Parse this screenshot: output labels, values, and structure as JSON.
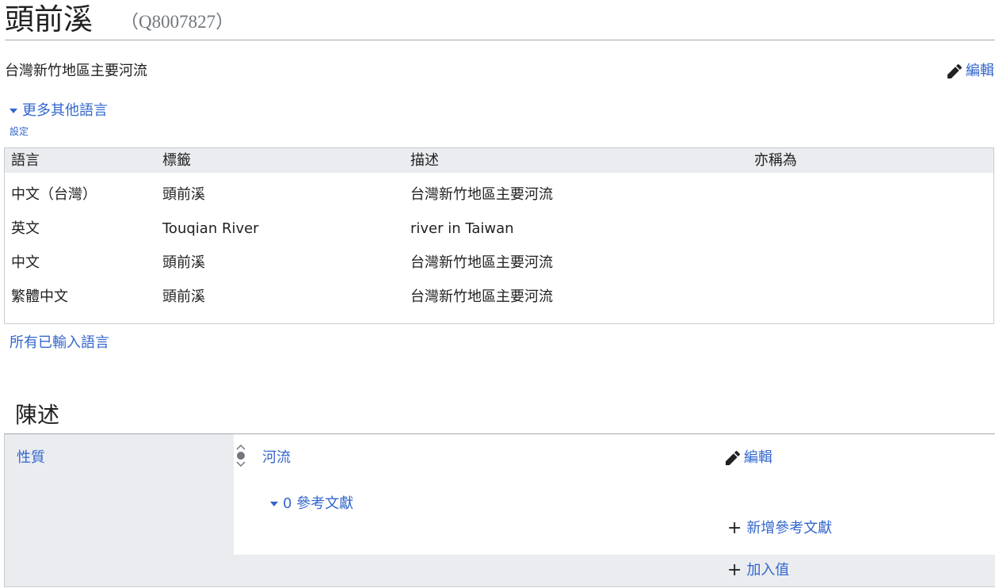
{
  "header": {
    "title": "頭前溪",
    "qid": "（Q8007827）"
  },
  "description": "台灣新竹地區主要河流",
  "edit_label": "編輯",
  "languages": {
    "toggle_label": "更多其他語言",
    "settings_label": "設定",
    "columns": [
      "語言",
      "標籤",
      "描述",
      "亦稱為"
    ],
    "rows": [
      {
        "language": "中文（台灣）",
        "label": "頭前溪",
        "description": "台灣新竹地區主要河流",
        "aliases": ""
      },
      {
        "language": "英文",
        "label": "Touqian River",
        "description": "river in Taiwan",
        "aliases": ""
      },
      {
        "language": "中文",
        "label": "頭前溪",
        "description": "台灣新竹地區主要河流",
        "aliases": ""
      },
      {
        "language": "繁體中文",
        "label": "頭前溪",
        "description": "台灣新竹地區主要河流",
        "aliases": ""
      }
    ],
    "all_languages_link": "所有已輸入語言"
  },
  "statements": {
    "heading": "陳述",
    "items": [
      {
        "property": "性質",
        "value": "河流",
        "edit_label": "編輯",
        "references": "0 參考文獻",
        "add_reference": "新增參考文獻",
        "add_value": "加入值"
      }
    ]
  },
  "colors": {
    "link": "#3366cc",
    "border": "#c8ccd1",
    "header_bg": "#eaecf0",
    "text": "#202122"
  },
  "icons": [
    "pencil-icon",
    "triangle-down-icon",
    "rank-normal-icon",
    "plus-icon"
  ]
}
